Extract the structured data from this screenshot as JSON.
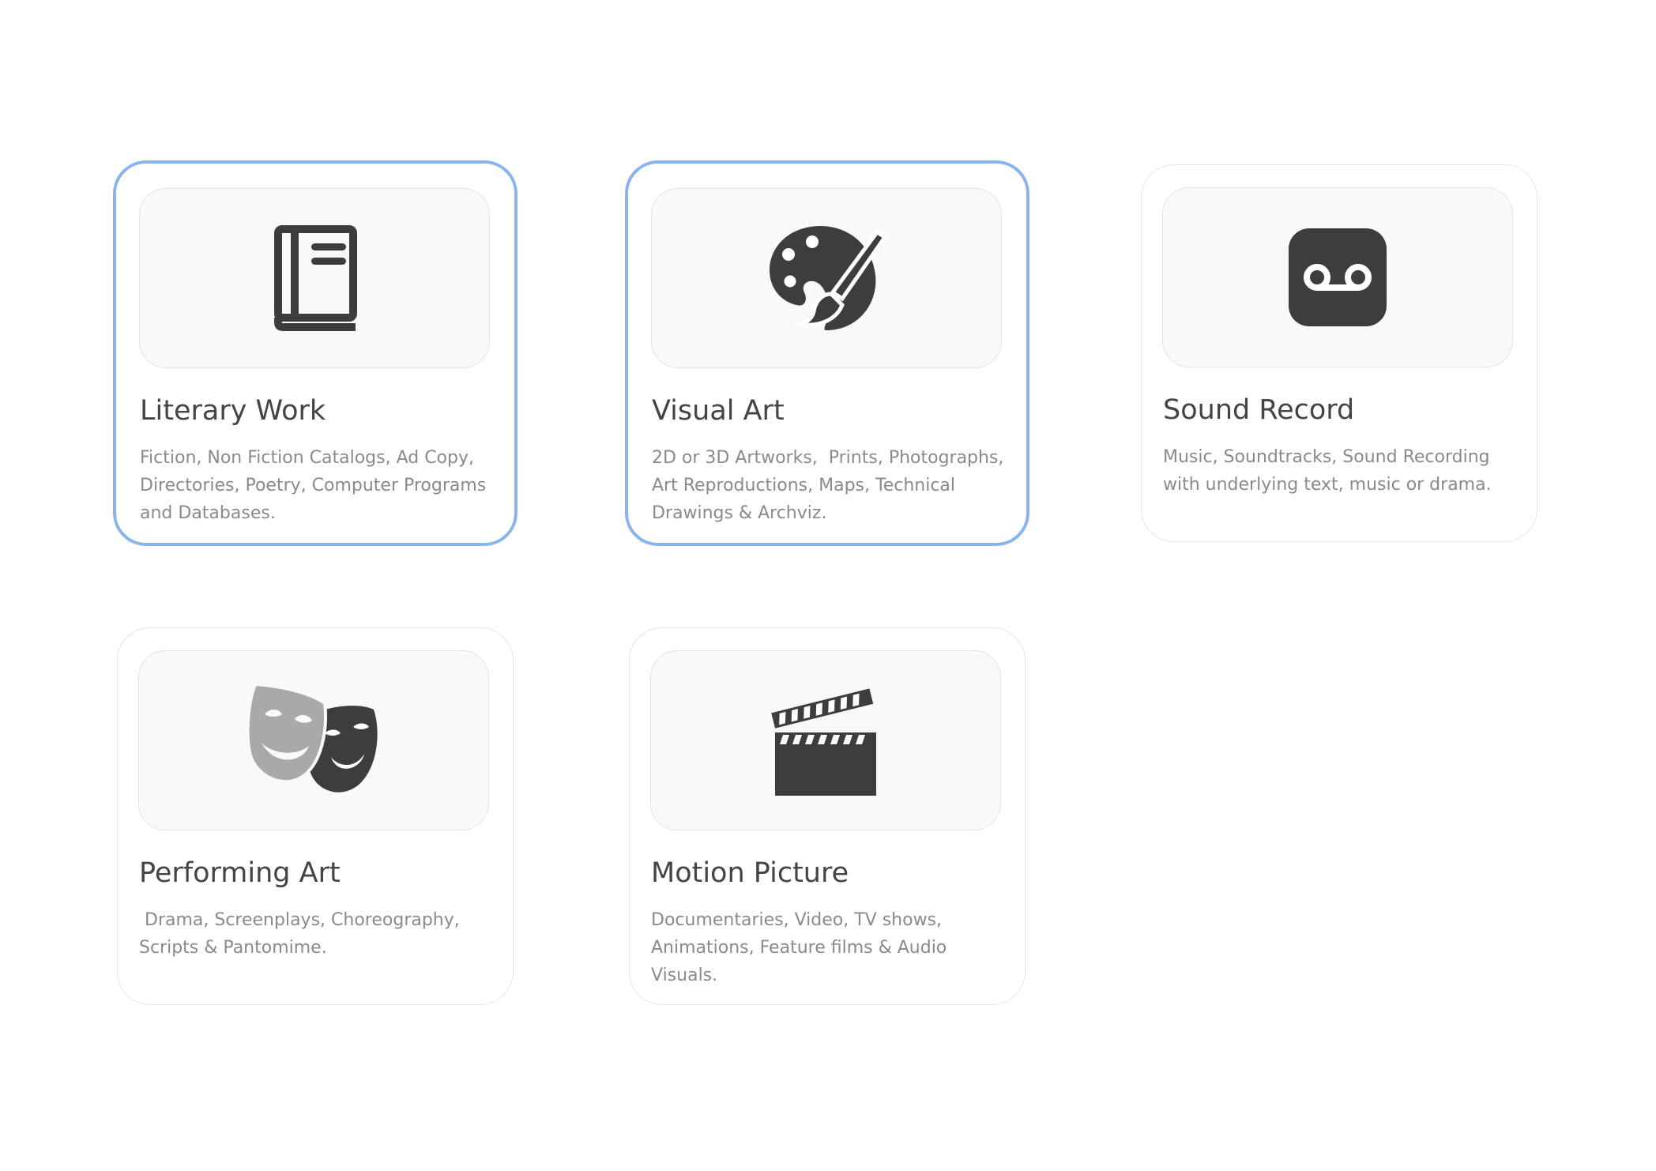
{
  "cards": [
    {
      "title": "Literary Work",
      "description": "Fiction, Non Fiction Catalogs, Ad Copy, Directories, Poetry, Computer Programs and Databases.",
      "icon": "book-icon",
      "selected": true
    },
    {
      "title": "Visual Art",
      "description": "2D or 3D Artworks,  Prints, Photographs, Art Reproductions, Maps, Technical Drawings & Archviz.",
      "icon": "palette-icon",
      "selected": true
    },
    {
      "title": "Sound Record",
      "description": "Music, Soundtracks, Sound Recording with underlying text, music or drama.",
      "icon": "voicemail-icon",
      "selected": false
    },
    {
      "title": "Performing Art",
      "description": " Drama, Screenplays, Choreography, Scripts & Pantomime.",
      "icon": "theater-masks-icon",
      "selected": false
    },
    {
      "title": "Motion Picture",
      "description": "Documentaries, Video, TV shows, Animations, Feature films & Audio Visuals.",
      "icon": "clapperboard-icon",
      "selected": false
    }
  ],
  "colors": {
    "selected_border": "#8ab4ec",
    "icon_dark": "#3d3d3d",
    "icon_light": "#a9a9a9",
    "title_text": "#444444",
    "description_text": "#8a8a8a"
  }
}
